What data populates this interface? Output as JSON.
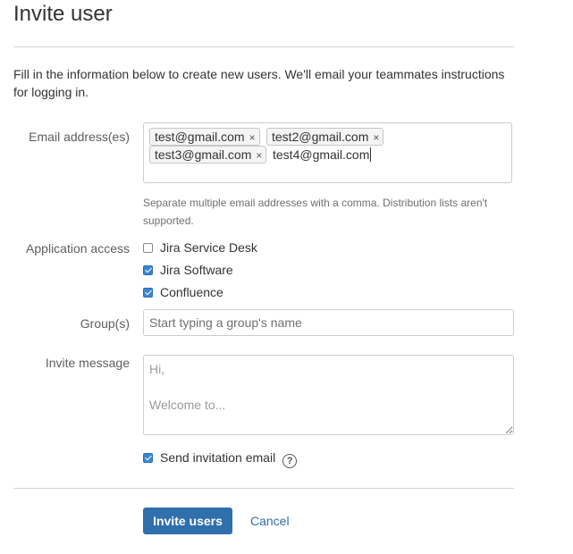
{
  "page": {
    "title": "Invite user",
    "intro": "Fill in the information below to create new users. We'll email your teammates instructions for logging in."
  },
  "email": {
    "label": "Email address(es)",
    "tokens": [
      "test@gmail.com",
      "test2@gmail.com",
      "test3@gmail.com"
    ],
    "remove_glyph": "×",
    "typed_value": "test4@gmail.com",
    "hint": "Separate multiple email addresses with a comma. Distribution lists aren't supported."
  },
  "app_access": {
    "label": "Application access",
    "options": [
      {
        "label": "Jira Service Desk",
        "checked": false
      },
      {
        "label": "Jira Software",
        "checked": true
      },
      {
        "label": "Confluence",
        "checked": true
      }
    ]
  },
  "groups": {
    "label": "Group(s)",
    "placeholder": "Start typing a group's name"
  },
  "invite_message": {
    "label": "Invite message",
    "placeholder": "Hi,\n\nWelcome to..."
  },
  "send_email": {
    "label": "Send invitation email",
    "checked": true,
    "help_glyph": "?"
  },
  "actions": {
    "submit_label": "Invite users",
    "cancel_label": "Cancel"
  },
  "colors": {
    "primary": "#2f6fab",
    "checkbox_checked": "#3b86d4"
  }
}
